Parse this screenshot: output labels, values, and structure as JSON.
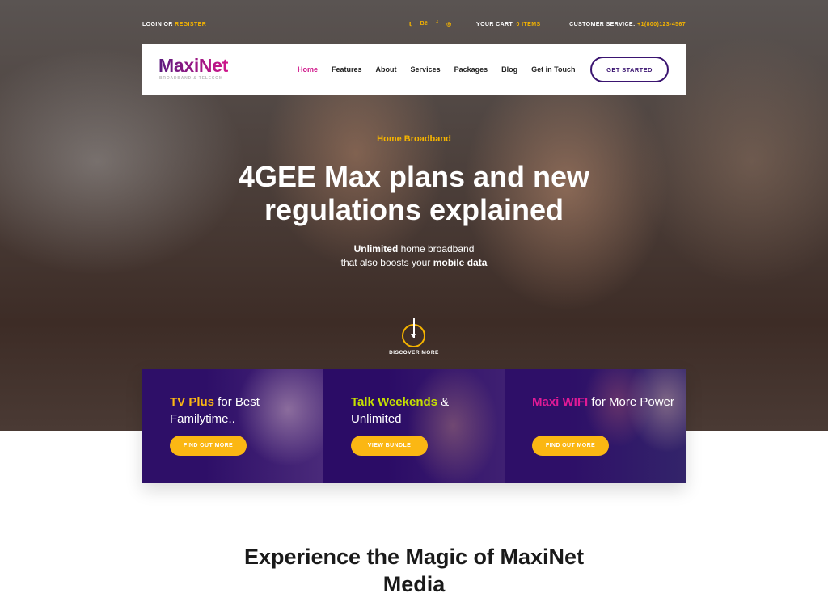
{
  "topbar": {
    "login": "LOGIN",
    "or": " OR ",
    "register": "REGISTER",
    "social": [
      "twitter-icon",
      "behance-icon",
      "facebook-icon",
      "instagram-icon"
    ],
    "social_glyphs": [
      "𝕥",
      "Bē",
      "f",
      "◎"
    ],
    "cart_label": "YOUR CART: ",
    "cart_value": "0 ITEMS",
    "cs_label": "CUSTOMER SERVICE: ",
    "cs_value": "+1(800)123-4567"
  },
  "nav": {
    "logo": "MaxiNet",
    "logo_sub": "BROADBAND & TELECOM",
    "items": [
      "Home",
      "Features",
      "About",
      "Services",
      "Packages",
      "Blog",
      "Get in Touch"
    ],
    "active": "Home",
    "cta": "GET STARTED"
  },
  "hero": {
    "eyebrow": "Home Broadband",
    "headline_1": "4GEE Max plans and new",
    "headline_2": "regulations explained",
    "sub_1_bold": "Unlimited",
    "sub_1_rest": " home broadband",
    "sub_2_start": "that also boosts your ",
    "sub_2_bold": "mobile data",
    "discover": "DISCOVER MORE"
  },
  "cards": [
    {
      "highlight": "TV Plus",
      "highlight_color": "#fbb713",
      "rest": " for Best Familytime..",
      "button": "FIND OUT MORE"
    },
    {
      "highlight": "Talk Weekends",
      "highlight_color": "#c6e000",
      "rest": " & Unlimited",
      "button": "VIEW BUNDLE"
    },
    {
      "highlight": "Maxi WIFI",
      "highlight_color": "#e01a96",
      "rest": " for More Power",
      "button": "FIND OUT MORE"
    }
  ],
  "section": {
    "title_1": "Experience the Magic of MaxiNet",
    "title_2": "Media"
  },
  "colors": {
    "accent": "#fbb713",
    "brand_purple": "#3a1470",
    "brand_pink": "#d0168a"
  }
}
